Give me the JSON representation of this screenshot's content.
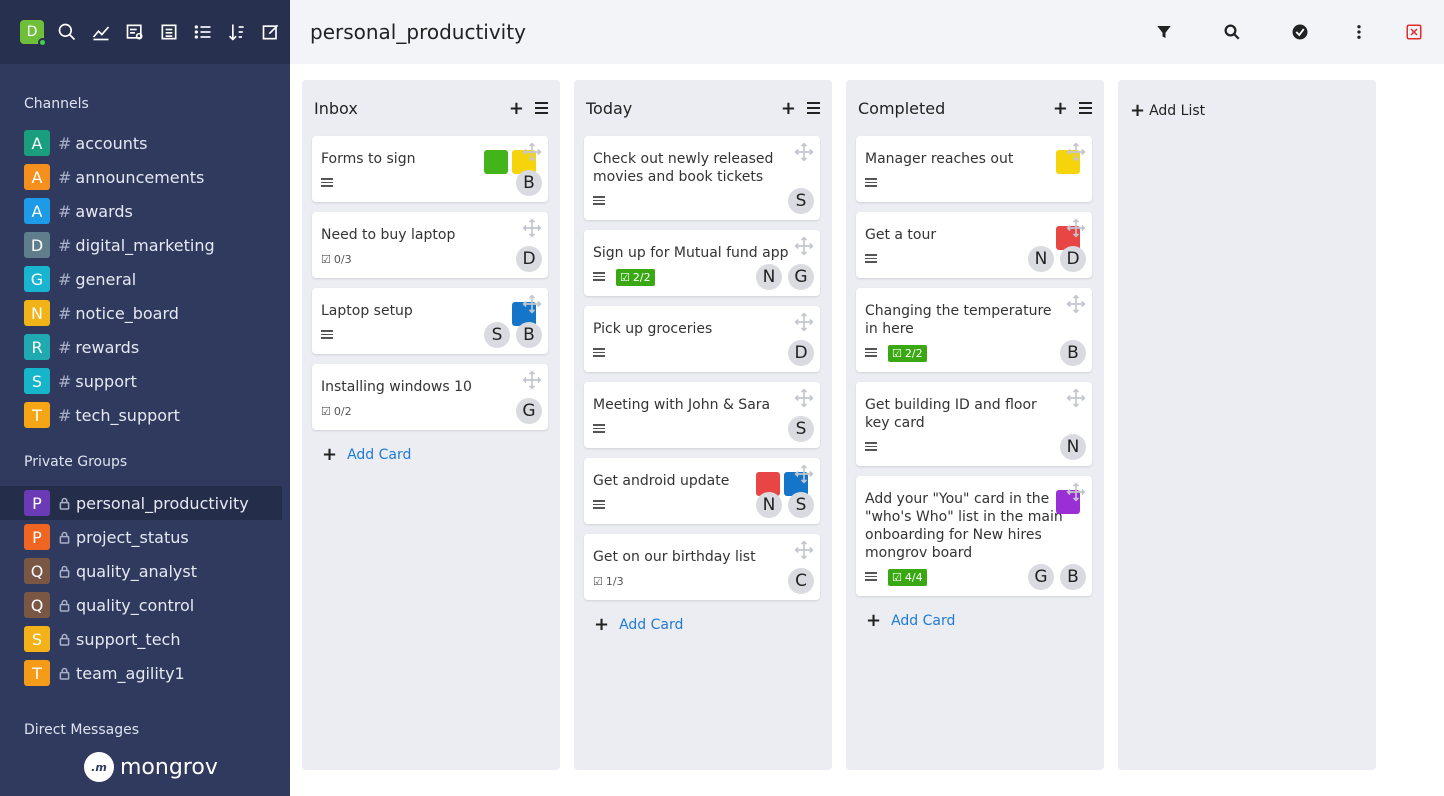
{
  "sidebar": {
    "user_initial": "D",
    "top_icons": [
      "search-icon",
      "chart-icon",
      "report-icon",
      "list-view-icon",
      "bullet-list-icon",
      "sort-icon",
      "compose-icon"
    ],
    "channels_title": "Channels",
    "channels": [
      {
        "letter": "A",
        "name": "accounts",
        "color": "#1a9e7e"
      },
      {
        "letter": "A",
        "name": "announcements",
        "color": "#f5901e"
      },
      {
        "letter": "A",
        "name": "awards",
        "color": "#1e9be6"
      },
      {
        "letter": "D",
        "name": "digital_marketing",
        "color": "#607d8b"
      },
      {
        "letter": "G",
        "name": "general",
        "color": "#19b4cf"
      },
      {
        "letter": "N",
        "name": "notice_board",
        "color": "#f2b318"
      },
      {
        "letter": "R",
        "name": "rewards",
        "color": "#1fa9b1"
      },
      {
        "letter": "S",
        "name": "support",
        "color": "#17b5c9"
      },
      {
        "letter": "T",
        "name": "tech_support",
        "color": "#f6a515"
      }
    ],
    "private_title": "Private Groups",
    "groups": [
      {
        "letter": "P",
        "name": "personal_productivity",
        "color": "#6a3bb5",
        "active": true
      },
      {
        "letter": "P",
        "name": "project_status",
        "color": "#f06522"
      },
      {
        "letter": "Q",
        "name": "quality_analyst",
        "color": "#7a5645"
      },
      {
        "letter": "Q",
        "name": "quality_control",
        "color": "#7a5645"
      },
      {
        "letter": "S",
        "name": "support_tech",
        "color": "#f3b21a"
      },
      {
        "letter": "T",
        "name": "team_agility1",
        "color": "#f59b17"
      }
    ],
    "dm_title": "Direct Messages",
    "logo_text": "mongrov",
    "logo_mark": ".m"
  },
  "header": {
    "title": "personal_productivity"
  },
  "lists": [
    {
      "title": "Inbox",
      "add_card": "Add Card",
      "cards": [
        {
          "title": "Forms to sign",
          "labels": [
            "#43b51b",
            "#f5d40c"
          ],
          "checklist": null,
          "members": [
            "B"
          ]
        },
        {
          "title": "Need to buy laptop",
          "labels": [],
          "checklist": "0/3",
          "members": [
            "D"
          ]
        },
        {
          "title": "Laptop setup",
          "labels": [
            "#1576c9"
          ],
          "checklist": null,
          "members": [
            "S",
            "B"
          ]
        },
        {
          "title": "Installing windows 10",
          "labels": [],
          "checklist": "0/2",
          "members": [
            "G"
          ]
        }
      ]
    },
    {
      "title": "Today",
      "add_card": "Add Card",
      "cards": [
        {
          "title": "Check out newly released movies and book tickets",
          "labels": [],
          "checklist": null,
          "members": [
            "S"
          ]
        },
        {
          "title": "Sign up for Mutual fund app",
          "labels": [],
          "checklist": "2/2",
          "done": true,
          "members": [
            "N",
            "G"
          ]
        },
        {
          "title": "Pick up groceries",
          "labels": [],
          "checklist": null,
          "members": [
            "D"
          ]
        },
        {
          "title": "Meeting with John & Sara",
          "labels": [],
          "checklist": null,
          "members": [
            "S"
          ]
        },
        {
          "title": "Get android update",
          "labels": [
            "#e84545",
            "#1576c9"
          ],
          "checklist": null,
          "members": [
            "N",
            "S"
          ]
        },
        {
          "title": "Get on our birthday list",
          "labels": [],
          "checklist": "1/3",
          "members": [
            "C"
          ]
        }
      ]
    },
    {
      "title": "Completed",
      "add_card": "Add Card",
      "cards": [
        {
          "title": "Manager reaches out",
          "labels": [
            "#f5d40c"
          ],
          "checklist": null,
          "members": []
        },
        {
          "title": "Get a tour",
          "labels": [
            "#e84545"
          ],
          "checklist": null,
          "members": [
            "N",
            "D"
          ]
        },
        {
          "title": "Changing the temperature in here",
          "labels": [],
          "checklist": "2/2",
          "done": true,
          "members": [
            "B"
          ]
        },
        {
          "title": "Get building ID and floor key card",
          "labels": [],
          "checklist": null,
          "members": [
            "N"
          ]
        },
        {
          "title": "Add your \"You\" card in the \"who's Who\" list in the main onboarding for New hires mongrov board",
          "labels": [
            "#9b2fd6"
          ],
          "checklist": "4/4",
          "done": true,
          "members": [
            "G",
            "B"
          ]
        }
      ]
    }
  ],
  "add_list": "Add List"
}
